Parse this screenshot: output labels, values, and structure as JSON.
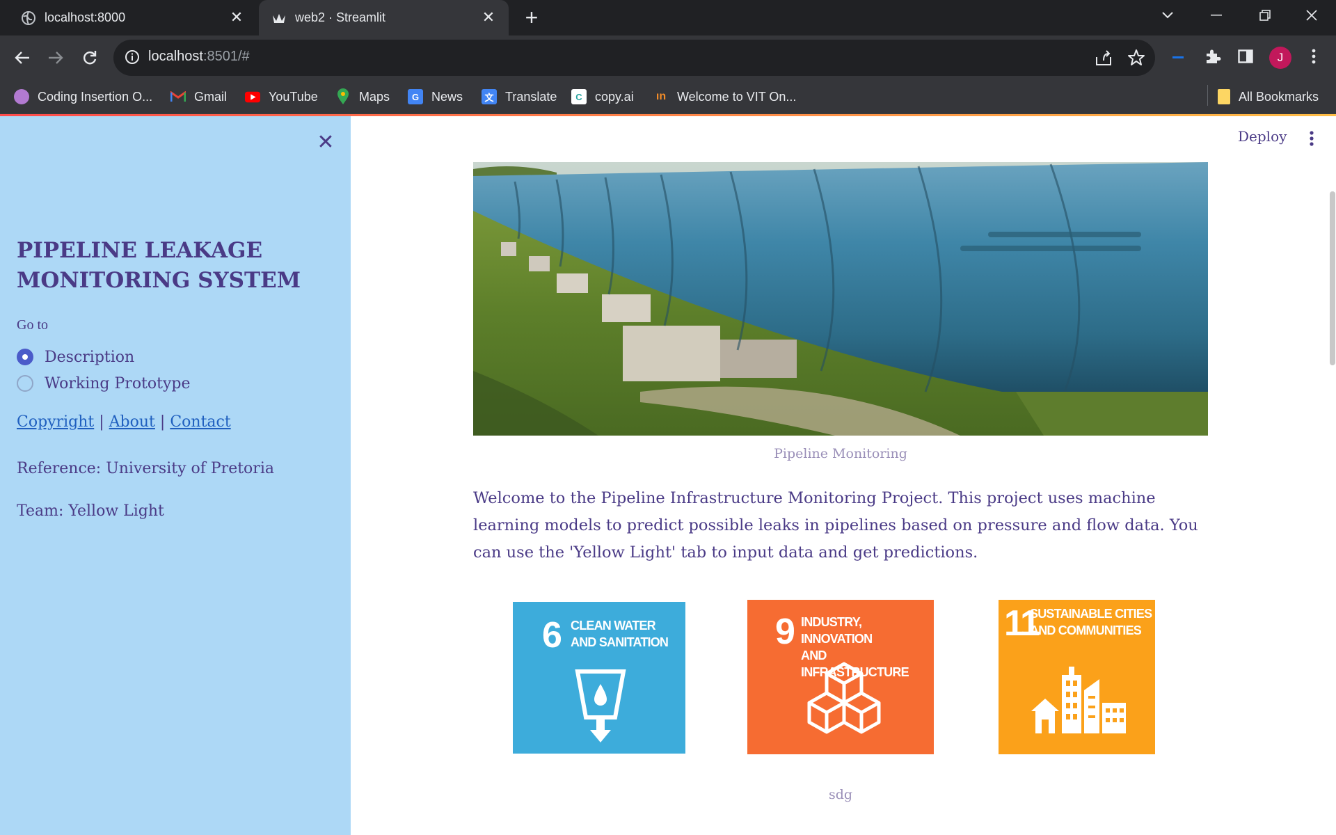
{
  "browser": {
    "tabs": [
      {
        "title": "localhost:8000",
        "icon": "globe-icon"
      },
      {
        "title": "web2 · Streamlit",
        "icon": "streamlit-crown-icon"
      }
    ],
    "url_host": "localhost",
    "url_rest": ":8501/#",
    "profile_initial": "J",
    "bookmarks": [
      {
        "label": "Coding Insertion O...",
        "icon": "coding-insertion-icon",
        "color": "#e07aa8"
      },
      {
        "label": "Gmail",
        "icon": "gmail-icon",
        "color": "#ea4335"
      },
      {
        "label": "YouTube",
        "icon": "youtube-icon",
        "color": "#ff0000"
      },
      {
        "label": "Maps",
        "icon": "maps-icon",
        "color": "#34a853"
      },
      {
        "label": "News",
        "icon": "news-icon",
        "color": "#4285f4"
      },
      {
        "label": "Translate",
        "icon": "translate-icon",
        "color": "#4285f4"
      },
      {
        "label": "copy.ai",
        "icon": "copyai-icon",
        "color": "#ffffff"
      },
      {
        "label": "Welcome to VIT On...",
        "icon": "vit-icon",
        "color": "#f28c28"
      }
    ],
    "all_bookmarks": "All Bookmarks"
  },
  "sidebar": {
    "title": "PIPELINE LEAKAGE MONITORING SYSTEM",
    "goto_label": "Go to",
    "options": [
      {
        "label": "Description",
        "selected": true
      },
      {
        "label": "Working Prototype",
        "selected": false
      }
    ],
    "links": [
      "Copyright",
      "About",
      "Contact"
    ],
    "separator": "|",
    "reference": "Reference: University of Pretoria",
    "team": "Team: Yellow Light"
  },
  "main": {
    "deploy_label": "Deploy",
    "hero_caption": "Pipeline Monitoring",
    "welcome_text": "Welcome to the Pipeline Infrastructure Monitoring Project. This project uses machine learning models to predict possible leaks in pipelines based on pressure and flow data. You can use the 'Yellow Light' tab to input data and get predictions.",
    "sdg_caption": "sdg",
    "sdgs": [
      {
        "number": "6",
        "line1": "CLEAN WATER",
        "line2": "AND SANITATION",
        "color": "#3dacdb"
      },
      {
        "number": "9",
        "line1": "INDUSTRY, INNOVATION",
        "line2": "AND INFRASTRUCTURE",
        "color": "#f66c32"
      },
      {
        "number": "11",
        "line1": "SUSTAINABLE CITIES",
        "line2": "AND COMMUNITIES",
        "color": "#fba11a"
      }
    ]
  },
  "colors": {
    "sidebar_bg": "#add8f6",
    "text_primary": "#4a3a86",
    "radio_accent": "#4b5bc9",
    "link": "#1f5fbf"
  }
}
